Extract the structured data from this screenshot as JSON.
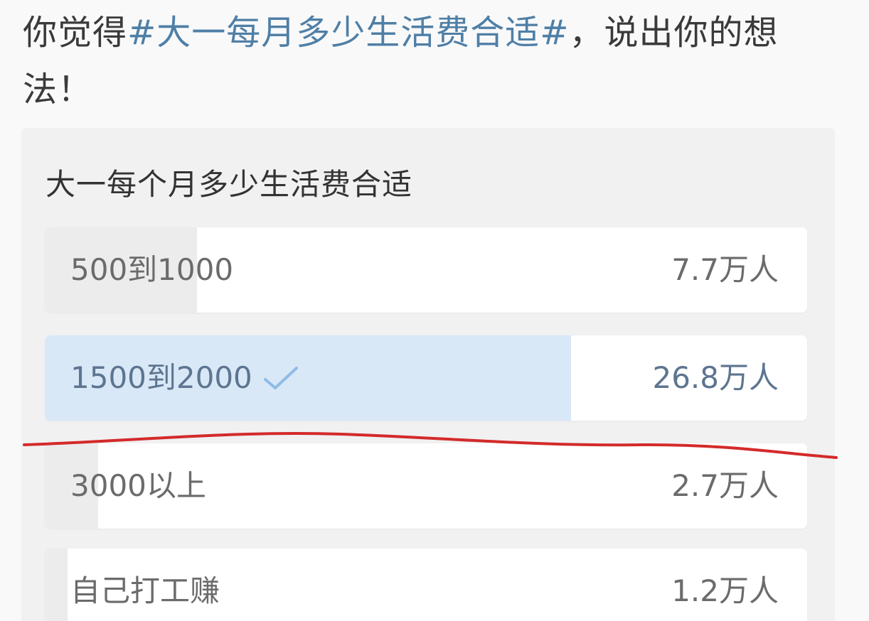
{
  "post": {
    "prefix": "你觉得",
    "hashtag": "#大一每月多少生活费合适#",
    "suffix": "，说出你的想法！"
  },
  "poll": {
    "title": "大一每个月多少生活费合适",
    "options": [
      {
        "label": "500到1000",
        "count": "7.7万人",
        "share": 0.2,
        "selected": false
      },
      {
        "label": "1500到2000",
        "count": "26.8万人",
        "share": 0.69,
        "selected": true
      },
      {
        "label": "3000以上",
        "count": "2.7万人",
        "share": 0.07,
        "selected": false
      },
      {
        "label": "自己打工赚",
        "count": "1.2万人",
        "share": 0.03,
        "selected": false
      }
    ]
  },
  "colors": {
    "hashtag": "#4f7fa6",
    "selected_fill": "#d9e8f7",
    "check": "#8fbbe6",
    "annotation_line": "#d42a2a"
  },
  "icons": {
    "selected_marker": "check-icon"
  }
}
